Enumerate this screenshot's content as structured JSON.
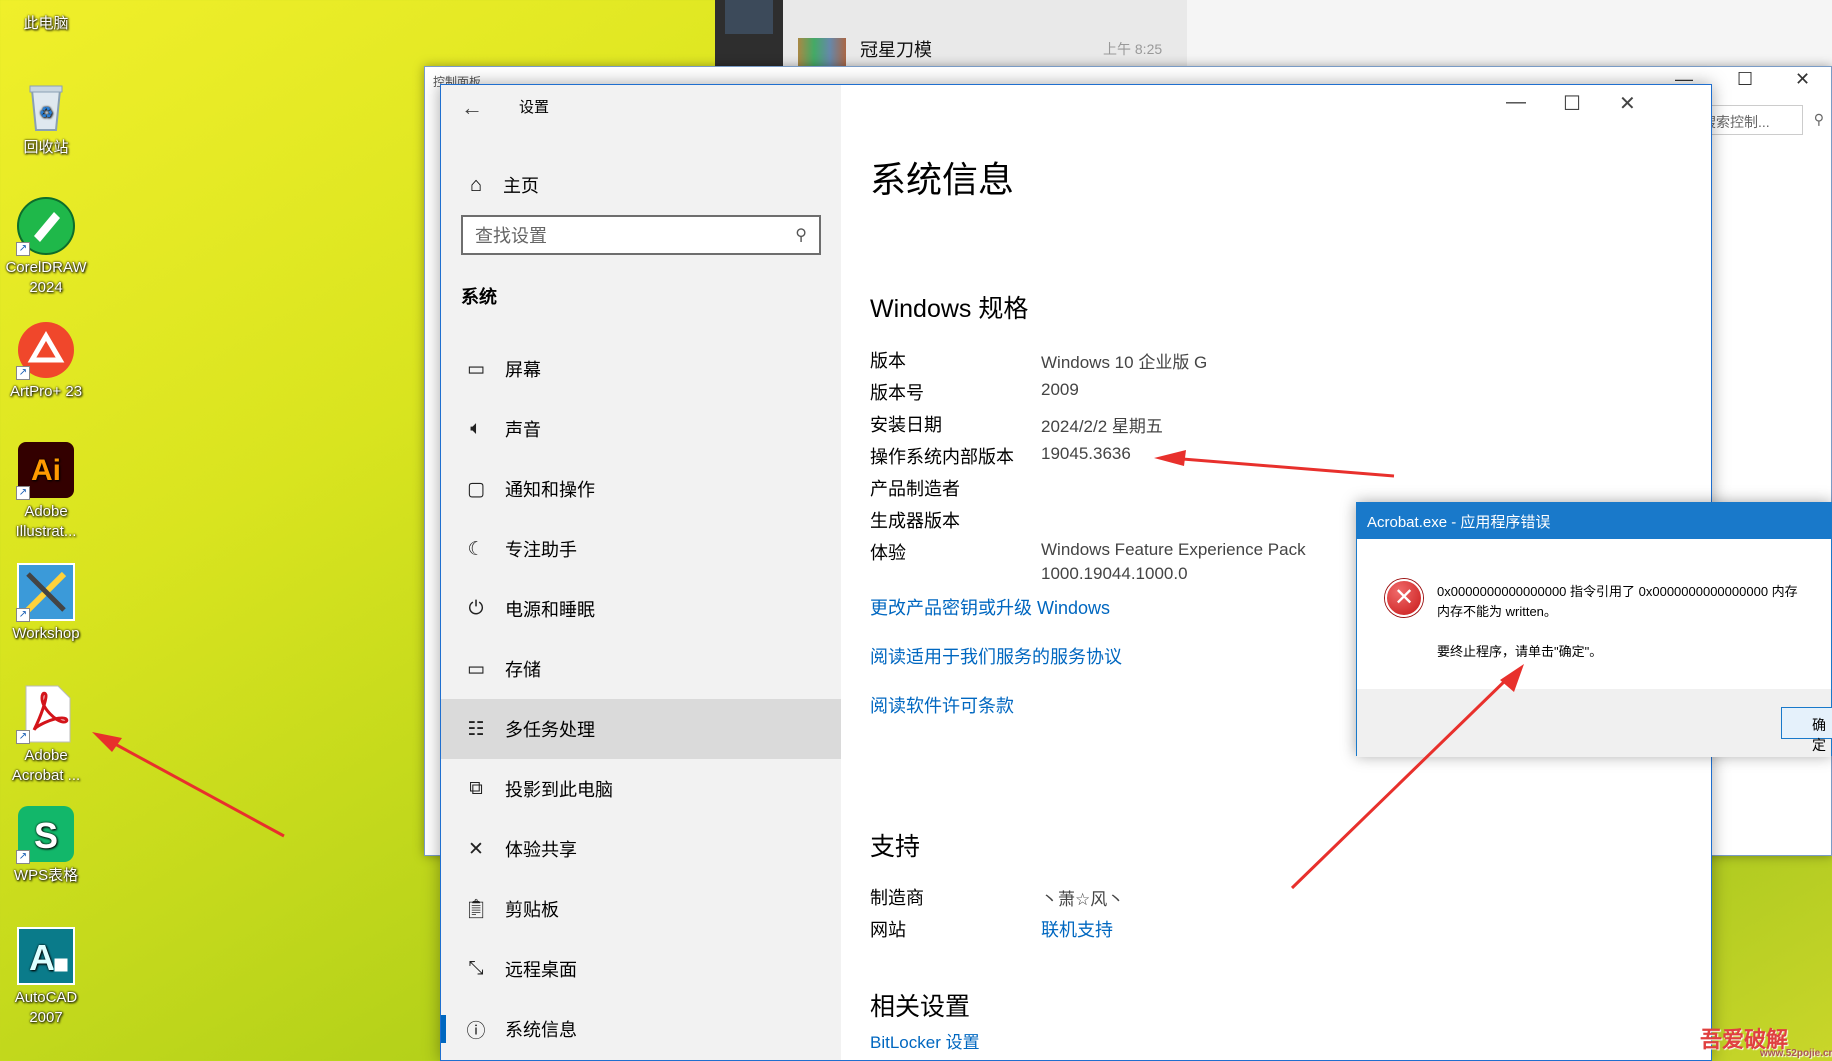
{
  "desktop": {
    "icons": [
      {
        "label": "此电脑"
      },
      {
        "label": "回收站"
      },
      {
        "label": "CorelDRAW 2024"
      },
      {
        "label": "ArtPro+ 23"
      },
      {
        "label": "Adobe Illustrat..."
      },
      {
        "label": "Workshop"
      },
      {
        "label": "Adobe Acrobat ..."
      },
      {
        "label": "WPS表格"
      },
      {
        "label": "AutoCAD 2007"
      }
    ]
  },
  "wechat": {
    "chat_title": "冠星刀模",
    "chat_time": "上午 8:25"
  },
  "control_panel": {
    "title": "控制面板",
    "search_placeholder": "搜索控制..."
  },
  "settings": {
    "window_title": "设置",
    "home_label": "主页",
    "search_placeholder": "查找设置",
    "section_label": "系统",
    "nav": [
      {
        "label": "屏幕",
        "icon": "monitor-icon"
      },
      {
        "label": "声音",
        "icon": "speaker-icon"
      },
      {
        "label": "通知和操作",
        "icon": "notification-icon"
      },
      {
        "label": "专注助手",
        "icon": "moon-icon"
      },
      {
        "label": "电源和睡眠",
        "icon": "power-icon"
      },
      {
        "label": "存储",
        "icon": "storage-icon"
      },
      {
        "label": "多任务处理",
        "icon": "multitask-icon"
      },
      {
        "label": "投影到此电脑",
        "icon": "project-icon"
      },
      {
        "label": "体验共享",
        "icon": "share-icon"
      },
      {
        "label": "剪贴板",
        "icon": "clipboard-icon"
      },
      {
        "label": "远程桌面",
        "icon": "remote-icon"
      },
      {
        "label": "系统信息",
        "icon": "info-icon"
      }
    ],
    "page_title": "系统信息",
    "spec_heading": "Windows 规格",
    "specs": [
      {
        "key": "版本",
        "value": "Windows 10 企业版 G"
      },
      {
        "key": "版本号",
        "value": "2009"
      },
      {
        "key": "安装日期",
        "value": "2024/2/2 星期五"
      },
      {
        "key": "操作系统内部版本",
        "value": "19045.3636"
      },
      {
        "key": "产品制造者",
        "value": ""
      },
      {
        "key": "生成器版本",
        "value": ""
      },
      {
        "key": "体验",
        "value": "Windows Feature Experience Pack",
        "value2": "1000.19044.1000.0"
      }
    ],
    "links": {
      "upgrade": "更改产品密钥或升级 Windows",
      "service": "阅读适用于我们服务的服务协议",
      "license": "阅读软件许可条款"
    },
    "support_heading": "支持",
    "support": {
      "maker_key": "制造商",
      "maker_value": "丶萧☆风丶",
      "site_key": "网站",
      "site_value": "联机支持"
    },
    "related_heading": "相关设置",
    "bitlocker": "BitLocker 设置"
  },
  "error_dialog": {
    "title": "Acrobat.exe - 应用程序错误",
    "line1": "0x0000000000000000 指令引用了 0x0000000000000000 内存",
    "line2": "内存不能为 written。",
    "line3": "要终止程序，请单击\"确定\"。",
    "ok_label": "确定"
  },
  "watermark": {
    "text": "吾爱破解",
    "sub": "www.52pojie.cn"
  },
  "colors": {
    "accent": "#0067c0",
    "dialog_bar": "#1979ca",
    "annotation": "#e8302c"
  }
}
